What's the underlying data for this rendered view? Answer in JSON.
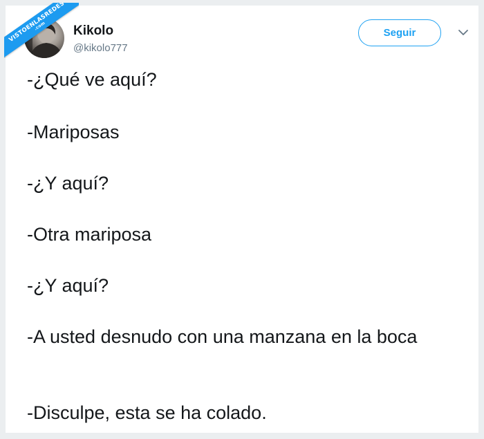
{
  "watermark": {
    "text": "VISTOENLASREDES",
    "subtext": ".com",
    "color": "#1d9bf0"
  },
  "author": {
    "name": "Kikolo",
    "handle": "@kikolo777"
  },
  "follow_button": {
    "label": "Seguir",
    "color": "#1da1f2"
  },
  "menu": {
    "icon": "chevron-down-icon"
  },
  "tweet": {
    "lines": [
      "-¿Qué ve aquí?",
      "-Mariposas",
      "-¿Y aquí?",
      "-Otra mariposa",
      "-¿Y aquí?",
      "-A usted desnudo con una manzana en la boca",
      "-Disculpe, esta se ha colado."
    ]
  }
}
